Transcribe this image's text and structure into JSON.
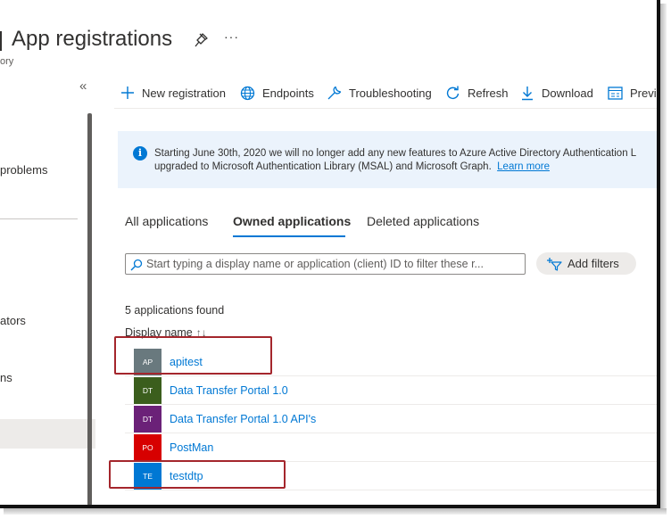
{
  "header": {
    "title": "App registrations",
    "subtitle": "ory",
    "pin_icon": "pin-icon",
    "more_label": "···"
  },
  "sidebar": {
    "collapse_label": "«",
    "items": [
      {
        "label": "problems"
      },
      {
        "label": "ators"
      },
      {
        "label": "ns"
      }
    ]
  },
  "toolbar": {
    "items": [
      {
        "label": "New registration",
        "icon": "plus-icon"
      },
      {
        "label": "Endpoints",
        "icon": "globe-icon"
      },
      {
        "label": "Troubleshooting",
        "icon": "wrench-icon"
      },
      {
        "label": "Refresh",
        "icon": "refresh-icon"
      },
      {
        "label": "Download",
        "icon": "download-icon"
      },
      {
        "label": "Previ",
        "icon": "preview-icon"
      }
    ]
  },
  "banner": {
    "icon_glyph": "i",
    "line1": "Starting June 30th, 2020 we will no longer add any new features to Azure Active Directory Authentication L",
    "line2": "upgraded to Microsoft Authentication Library (MSAL) and Microsoft Graph.",
    "link": "Learn more"
  },
  "tabs": [
    {
      "label": "All applications",
      "active": false
    },
    {
      "label": "Owned applications",
      "active": true
    },
    {
      "label": "Deleted applications",
      "active": false
    }
  ],
  "search": {
    "placeholder": "Start typing a display name or application (client) ID to filter these r...",
    "value": ""
  },
  "filters": {
    "add_label": "Add filters"
  },
  "results": {
    "count_text": "5 applications found",
    "column_header": "Display name",
    "sort_glyph": "↑↓"
  },
  "apps": [
    {
      "initials": "AP",
      "name": "apitest",
      "color": "#69797e",
      "highlighted": true
    },
    {
      "initials": "DT",
      "name": "Data Transfer Portal 1.0",
      "color": "#3b5e1d",
      "highlighted": false
    },
    {
      "initials": "DT",
      "name": "Data Transfer Portal 1.0 API's",
      "color": "#6b2178",
      "highlighted": false
    },
    {
      "initials": "PO",
      "name": "PostMan",
      "color": "#d70000",
      "highlighted": false
    },
    {
      "initials": "TE",
      "name": "testdtp",
      "color": "#0078d4",
      "highlighted": true
    }
  ],
  "colors": {
    "accent": "#0078d4",
    "highlight_box": "#a4262c",
    "banner_bg": "#ebf3fc"
  }
}
